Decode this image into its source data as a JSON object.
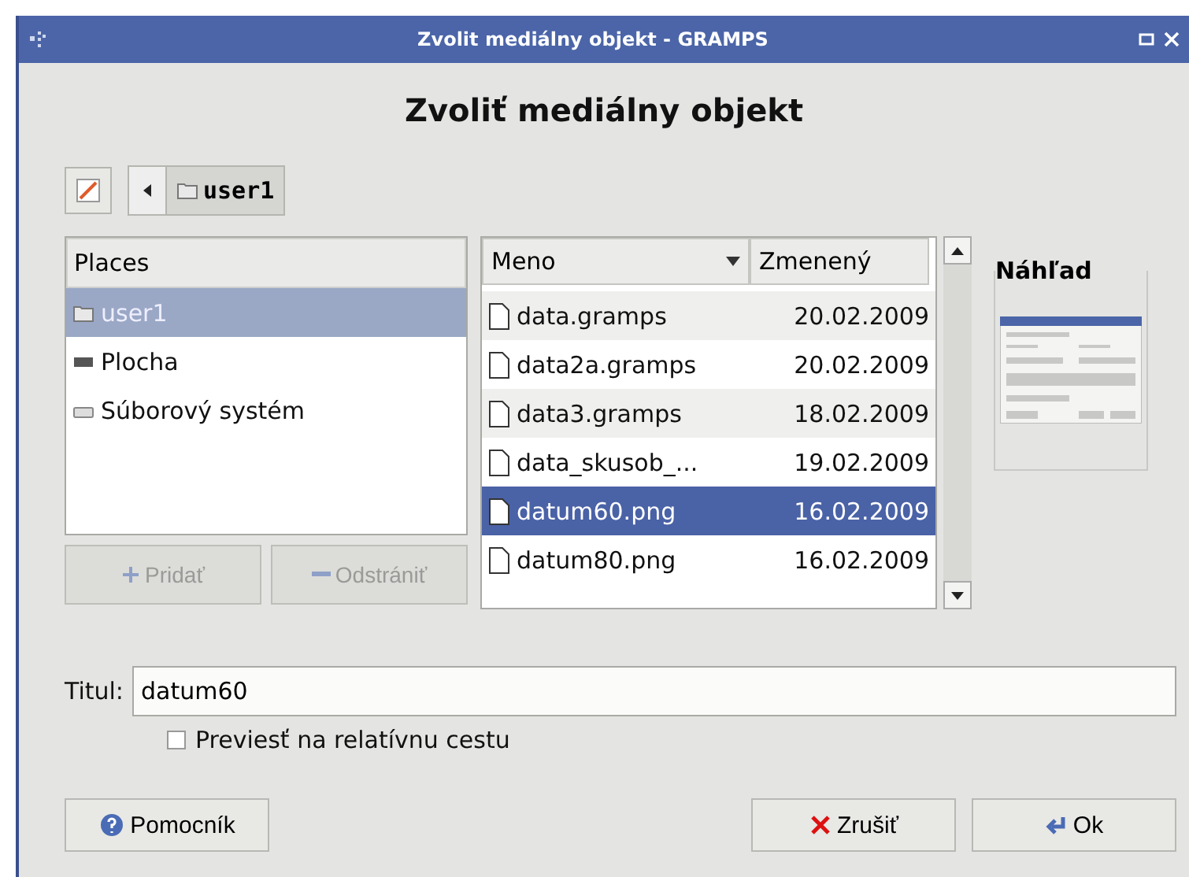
{
  "window": {
    "title": "Zvolit mediálny objekt - GRAMPS"
  },
  "heading": "Zvoliť mediálny objekt",
  "path": {
    "segments": [
      {
        "label": "user1",
        "selected": true
      }
    ]
  },
  "places": {
    "header": "Places",
    "items": [
      {
        "label": "user1",
        "kind": "folder",
        "selected": true
      },
      {
        "label": "Plocha",
        "kind": "desktop",
        "selected": false
      },
      {
        "label": "Súborový systém",
        "kind": "drive",
        "selected": false
      }
    ],
    "buttons": [
      {
        "label": "Pridať",
        "kind": "add",
        "disabled": true
      },
      {
        "label": "Odstrániť",
        "kind": "remove",
        "disabled": true
      }
    ]
  },
  "files": {
    "columns": [
      "Meno",
      "Zmenený"
    ],
    "rows": [
      {
        "name": "data.gramps",
        "modified": "20.02.2009",
        "selected": false
      },
      {
        "name": "data2a.gramps",
        "modified": "20.02.2009",
        "selected": false
      },
      {
        "name": "data3.gramps",
        "modified": "18.02.2009",
        "selected": false
      },
      {
        "name": "data_skusob_...",
        "modified": "19.02.2009",
        "selected": false
      },
      {
        "name": "datum60.png",
        "modified": "16.02.2009",
        "selected": true
      },
      {
        "name": "datum80.png",
        "modified": "16.02.2009",
        "selected": false
      }
    ]
  },
  "preview": {
    "title": "Náhľad"
  },
  "title_field": {
    "label": "Titul:",
    "value": "datum60"
  },
  "relative_path": {
    "label": "Previesť na relatívnu cestu",
    "checked": false
  },
  "buttons": [
    {
      "label": "Pomocník",
      "kind": "help"
    },
    {
      "label": "Zrušiť",
      "kind": "cancel"
    },
    {
      "label": "Ok",
      "kind": "ok"
    }
  ]
}
